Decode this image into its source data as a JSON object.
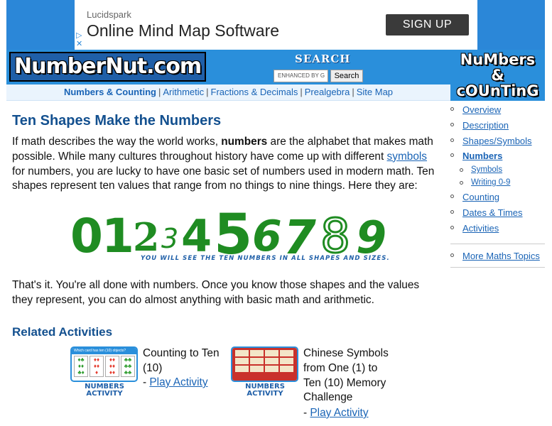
{
  "ad": {
    "brand": "Lucidspark",
    "title": "Online Mind Map Software",
    "cta": "SIGN UP",
    "adchoices": "▷\n✕"
  },
  "header": {
    "logo": "NumberNut.com",
    "search_title": "SEARCH",
    "search_placeholder": "ENHANCED BY G",
    "search_button": "Search",
    "side_logo": "NuMbers\n&\ncOUnTinG"
  },
  "nav": {
    "items": [
      "Numbers & Counting",
      "Arithmetic",
      "Fractions & Decimals",
      "Prealgebra",
      "Site Map"
    ],
    "separator": "|"
  },
  "main": {
    "title": "Ten Shapes Make the Numbers",
    "intro_a": "If math describes the way the world works, ",
    "intro_bold": "numbers",
    "intro_b": " are the alphabet that makes math possible. While many cultures throughout history have come up with different ",
    "intro_link": "symbols",
    "intro_c": " for numbers, you are lucky to have one basic set of numbers used in modern math. Ten shapes represent ten values that range from no things to nine things. Here they are:",
    "digits": [
      "0",
      "1",
      "2",
      "3",
      "4",
      "5",
      "6",
      "7",
      "8",
      "9"
    ],
    "digits_caption": "YOU WILL SEE THE TEN NUMBERS IN ALL SHAPES AND SIZES.",
    "outro": "That's it. You're all done with numbers. Once you know those shapes and the values they represent, you can do almost anything with basic math and arithmetic.",
    "related_title": "Related Activities",
    "activities": [
      {
        "title": "Counting to Ten (10)",
        "label": "NUMBERS ACTIVITY",
        "link_prefix": "- ",
        "link": "Play Activity",
        "thumb_caption": "Which card has ten (10) objects?"
      },
      {
        "title": "Chinese Symbols from One (1) to Ten (10) Memory Challenge",
        "label": "NUMBERS ACTIVITY",
        "link_prefix": "- ",
        "link": "Play Activity"
      }
    ]
  },
  "sidebar": {
    "items": [
      {
        "label": "Overview",
        "sub": false,
        "active": false
      },
      {
        "label": "Description",
        "sub": false,
        "active": false
      },
      {
        "label": "Shapes/Symbols",
        "sub": false,
        "active": false
      },
      {
        "label": "Numbers",
        "sub": false,
        "active": true
      },
      {
        "label": "Symbols",
        "sub": true,
        "active": false
      },
      {
        "label": "Writing 0-9",
        "sub": true,
        "active": false
      },
      {
        "label": "Counting",
        "sub": false,
        "active": false
      },
      {
        "label": "Dates & Times",
        "sub": false,
        "active": false
      },
      {
        "label": "Activities",
        "sub": false,
        "active": false
      }
    ],
    "more": "More Maths Topics"
  },
  "colors": {
    "header_blue": "#2a8fdb",
    "title_blue": "#13508f",
    "link_blue": "#1a64b6",
    "digit_green": "#1f8c22"
  }
}
